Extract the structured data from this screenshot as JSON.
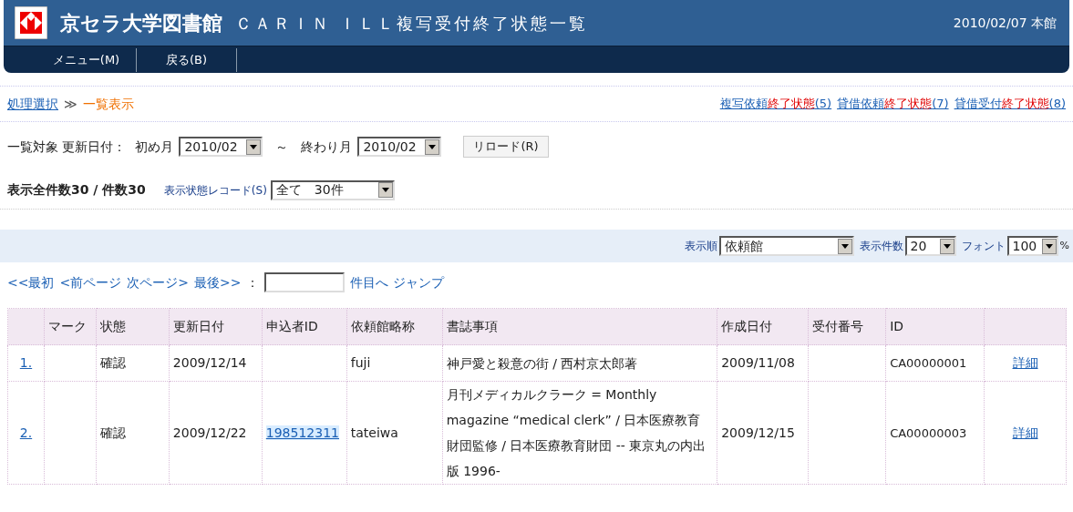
{
  "header": {
    "library": "京セラ大学図書館",
    "title": "ＣＡＲＩＮ ＩＬＬ複写受付終了状態一覧",
    "date": "2010/02/07 本館"
  },
  "menu": [
    "メニュー(M)",
    "戻る(B)"
  ],
  "breadcrumb": {
    "link": "処理選択",
    "separator": "≫",
    "current": "一覧表示"
  },
  "status_links": [
    {
      "parts": [
        {
          "text": "複写依頼",
          "emphasis": false
        },
        {
          "text": "終了状態",
          "emphasis": true
        },
        {
          "text": "(5)",
          "emphasis": false
        }
      ]
    },
    {
      "parts": [
        {
          "text": "貸借依頼",
          "emphasis": false
        },
        {
          "text": "終了状態",
          "emphasis": true
        },
        {
          "text": "(7)",
          "emphasis": false
        }
      ]
    },
    {
      "parts": [
        {
          "text": "貸借受付",
          "emphasis": false
        },
        {
          "text": "終了状態",
          "emphasis": true
        },
        {
          "text": "(8)",
          "emphasis": false
        }
      ]
    }
  ],
  "filter": {
    "label": "一覧対象 更新日付：",
    "start_label": "初め月",
    "start_value": "2010/02",
    "tilde": "～",
    "end_label": "終わり月",
    "end_value": "2010/02",
    "reload": "リロード(R)"
  },
  "counts": {
    "text": "表示全件数30 / 件数30",
    "record_label": "表示状態レコード(S)",
    "record_value": "全て　30件"
  },
  "display": {
    "order_label": "表示順",
    "order_value": "依頼館",
    "count_label": "表示件数",
    "count_value": "20",
    "font_label": "フォント",
    "font_value": "100",
    "percent": "%"
  },
  "pager": {
    "links": [
      "<<最初",
      "<前ページ",
      "次ページ>",
      "最後>>"
    ],
    "colon": "：",
    "jump": "件目へ ジャンプ"
  },
  "table": {
    "columns": [
      "マーク",
      "状態",
      "更新日付",
      "申込者ID",
      "依頼館略称",
      "書誌事項",
      "作成日付",
      "受付番号",
      "ID"
    ],
    "rows": [
      {
        "number": "1.",
        "mark": "",
        "state": "確認",
        "updated": "2009/12/14",
        "applicant": "",
        "library": "fuji",
        "bib": "神戸愛と殺意の街 / 西村京太郎著",
        "created": "2009/11/08",
        "receipt": "",
        "id": "CA00000001",
        "detail": "詳細"
      },
      {
        "number": "2.",
        "mark": "",
        "state": "確認",
        "updated": "2009/12/22",
        "applicant": "198512311",
        "library": "tateiwa",
        "bib": "月刊メディカルクラーク = Monthly magazine “medical clerk” / 日本医療教育財団監修 / 日本医療教育財団 -- 東京丸の内出版 1996-",
        "created": "2009/12/15",
        "receipt": "",
        "id": "CA00000003",
        "detail": "詳細"
      }
    ]
  }
}
